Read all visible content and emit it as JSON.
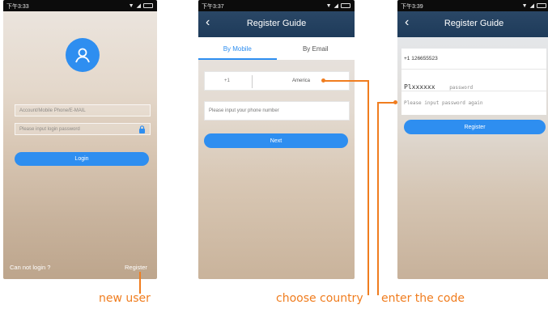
{
  "screen1": {
    "time": "下午3:33",
    "account_placeholder": "Account/Mobile Phone/E-MAIL",
    "password_placeholder": "Please input login password",
    "login_label": "Login",
    "cannot_login_label": "Can not login ?",
    "register_label": "Register"
  },
  "screen2": {
    "time": "下午3:37",
    "title": "Register Guide",
    "tab_mobile": "By Mobile",
    "tab_email": "By Email",
    "country_code": "+1",
    "country_name": "America",
    "phone_placeholder": "Please input your phone number",
    "next_label": "Next"
  },
  "screen3": {
    "time": "下午3:39",
    "title": "Register Guide",
    "phone_value": "+1 126655523",
    "code_prefix": "Pl",
    "code_value": "xxxxxx",
    "password_placeholder": "password",
    "password_again_placeholder": "Please input password again",
    "register_label": "Register"
  },
  "annotations": {
    "new_user": "new user",
    "choose_country": "choose country",
    "enter_code": "enter the code"
  },
  "colors": {
    "accent": "#2e8ef0",
    "header": "#1f3c5c",
    "annotation": "#f07d1f"
  },
  "icons": {
    "status": [
      "wifi-icon",
      "signal-icon",
      "battery-icon"
    ],
    "avatar": "user-icon",
    "lock": "lock-icon",
    "back": "back-arrow-icon"
  }
}
